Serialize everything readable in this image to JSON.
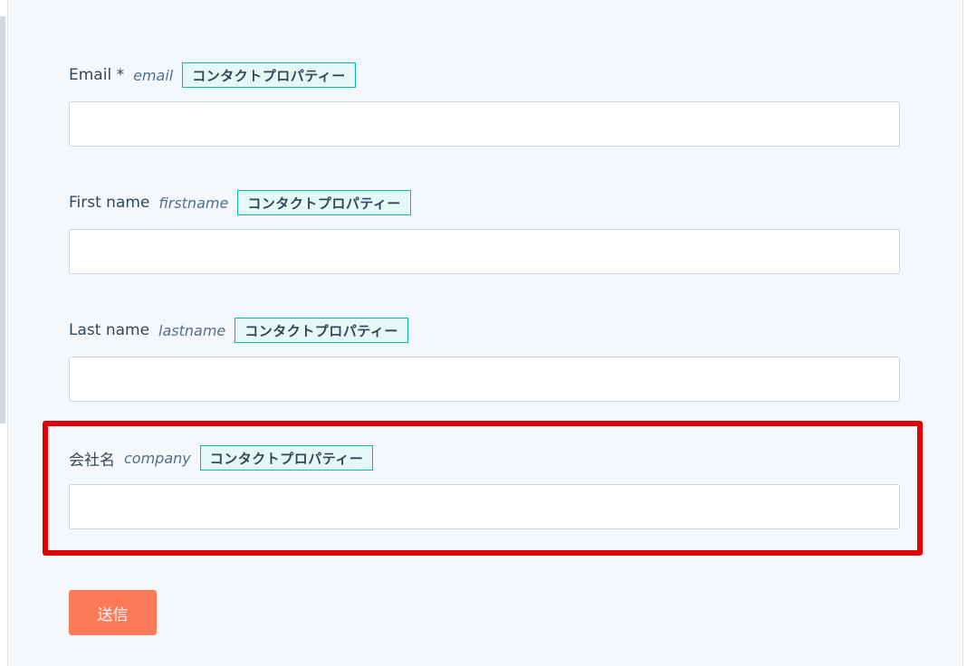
{
  "form": {
    "fields": [
      {
        "label": "Email *",
        "internal_name": "email",
        "badge": "コンタクトプロパティー",
        "value": ""
      },
      {
        "label": "First name",
        "internal_name": "firstname",
        "badge": "コンタクトプロパティー",
        "value": ""
      },
      {
        "label": "Last name",
        "internal_name": "lastname",
        "badge": "コンタクトプロパティー",
        "value": ""
      },
      {
        "label": "会社名",
        "internal_name": "company",
        "badge": "コンタクトプロパティー",
        "value": ""
      }
    ],
    "submit_label": "送信"
  },
  "colors": {
    "background": "#f5f8fa",
    "badge_border": "#00bda5",
    "badge_fill": "#e5f8f6",
    "highlight": "#e00000",
    "submit": "#ff7a59"
  }
}
